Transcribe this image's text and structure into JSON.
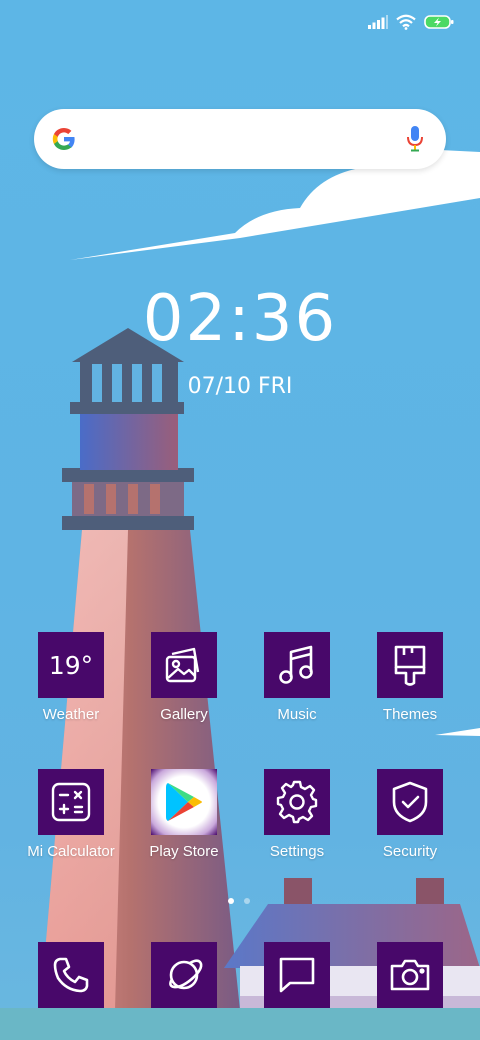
{
  "status_bar": {
    "icons": [
      "signal-icon",
      "wifi-icon",
      "battery-charging-icon"
    ],
    "accent_color": "#4cd964"
  },
  "search_bar": {
    "icons": [
      "google-logo-icon",
      "mic-icon"
    ]
  },
  "clock": {
    "time": "02:36",
    "date": "07/10",
    "weekday": "FRI"
  },
  "apps_row1": [
    {
      "label": "Weather",
      "icon": "weather-icon",
      "value": "19°"
    },
    {
      "label": "Gallery",
      "icon": "gallery-icon"
    },
    {
      "label": "Music",
      "icon": "music-icon"
    },
    {
      "label": "Themes",
      "icon": "themes-icon"
    }
  ],
  "apps_row2": [
    {
      "label": "Mi Calculator",
      "icon": "calculator-icon"
    },
    {
      "label": "Play Store",
      "icon": "play-store-icon"
    },
    {
      "label": "Settings",
      "icon": "gear-icon"
    },
    {
      "label": "Security",
      "icon": "shield-icon"
    }
  ],
  "dock": [
    {
      "icon": "phone-icon"
    },
    {
      "icon": "browser-icon"
    },
    {
      "icon": "messages-icon"
    },
    {
      "icon": "camera-icon"
    }
  ],
  "page_indicator": {
    "current_page": 1,
    "total_pages": 2
  },
  "colors": {
    "tile": "#48086a",
    "sky": "#5db6e6"
  }
}
